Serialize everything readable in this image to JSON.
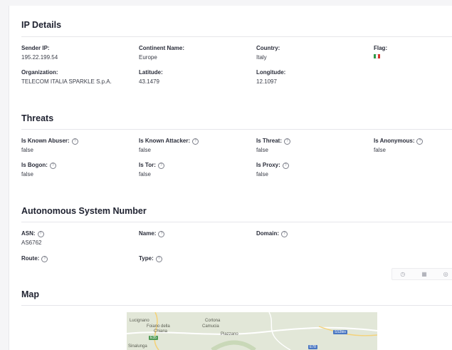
{
  "ip_details": {
    "title": "IP Details",
    "sender_ip": {
      "label": "Sender IP:",
      "value": "195.22.199.54"
    },
    "continent": {
      "label": "Continent Name:",
      "value": "Europe"
    },
    "country": {
      "label": "Country:",
      "value": "Italy"
    },
    "flag": {
      "label": "Flag:",
      "colors": [
        "#2d9a47",
        "#ffffff",
        "#d8362f"
      ]
    },
    "organization": {
      "label": "Organization:",
      "value": "TELECOM ITALIA SPARKLE S.p.A."
    },
    "latitude": {
      "label": "Latitude:",
      "value": "43.1479"
    },
    "longitude": {
      "label": "Longitude:",
      "value": "12.1097"
    }
  },
  "threats": {
    "title": "Threats",
    "known_abuser": {
      "label": "Is Known Abuser:",
      "value": "false"
    },
    "known_attacker": {
      "label": "Is Known Attacker:",
      "value": "false"
    },
    "is_threat": {
      "label": "Is Threat:",
      "value": "false"
    },
    "anonymous": {
      "label": "Is Anonymous:",
      "value": "false"
    },
    "bogon": {
      "label": "Is Bogon:",
      "value": "false"
    },
    "tor": {
      "label": "Is Tor:",
      "value": "false"
    },
    "proxy": {
      "label": "Is Proxy:",
      "value": "false"
    }
  },
  "asn": {
    "title": "Autonomous System Number",
    "asn": {
      "label": "ASN:",
      "value": "AS6762"
    },
    "name": {
      "label": "Name:",
      "value": ""
    },
    "domain": {
      "label": "Domain:",
      "value": ""
    },
    "route": {
      "label": "Route:",
      "value": ""
    },
    "type": {
      "label": "Type:",
      "value": ""
    }
  },
  "toolbar": {
    "icons": [
      "clock-icon",
      "grid-icon",
      "comment-icon"
    ],
    "glyphs": [
      "◷",
      "▦",
      "◎"
    ]
  },
  "map": {
    "title": "Map",
    "places": [
      "Lucignano",
      "Foiano della",
      "Chiana",
      "Cortona",
      "Camucia",
      "Piazzano",
      "Sinalunga"
    ],
    "roads": [
      "E35",
      "SS3bis",
      "E78"
    ]
  }
}
